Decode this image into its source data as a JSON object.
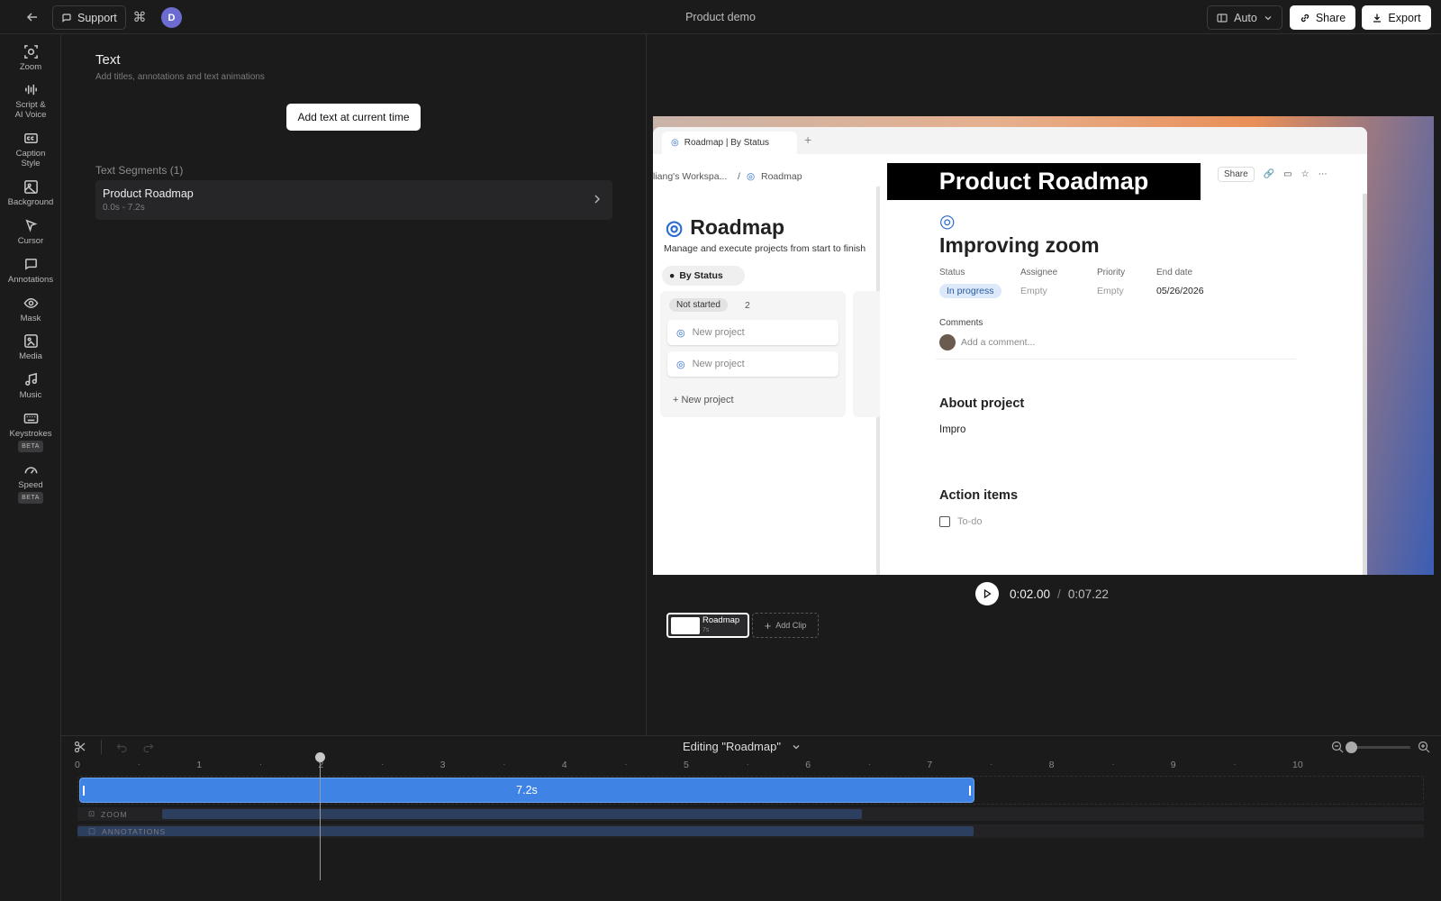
{
  "topbar": {
    "back_icon": "arrow-left-icon",
    "support_label": "Support",
    "avatar_initial": "D",
    "title": "Product demo",
    "aspect_label": "Auto",
    "share_label": "Share",
    "export_label": "Export"
  },
  "rail": {
    "items": [
      {
        "label": "Zoom",
        "icon": "zoom-icon"
      },
      {
        "label": "Script &",
        "label2": "AI Voice",
        "icon": "waveform-icon"
      },
      {
        "label": "Caption",
        "label2": "Style",
        "icon": "caption-icon"
      },
      {
        "label": "Background",
        "icon": "image-icon"
      },
      {
        "label": "Cursor",
        "icon": "cursor-icon"
      },
      {
        "label": "Annotations",
        "icon": "annotation-icon"
      },
      {
        "label": "Mask",
        "icon": "eye-icon"
      },
      {
        "label": "Media",
        "icon": "media-icon"
      },
      {
        "label": "Music",
        "icon": "music-icon"
      },
      {
        "label": "Keystrokes",
        "badge": "BETA",
        "icon": "keyboard-icon"
      },
      {
        "label": "Speed",
        "badge": "BETA",
        "icon": "speed-icon"
      }
    ]
  },
  "panel": {
    "title": "Text",
    "subtitle": "Add titles, annotations and text animations",
    "add_button": "Add text at current time",
    "segments_heading": "Text Segments (1)",
    "segments": [
      {
        "name": "Product Roadmap",
        "time": "0.0s - 7.2s"
      }
    ]
  },
  "preview": {
    "tab_label": "Roadmap | By Status",
    "crumb_workspace": "liang's Workspa...",
    "crumb_sep": "/",
    "crumb_page": "Roadmap",
    "overlay_text": "Product Roadmap",
    "share_label": "Share",
    "roadmap_title": "Roadmap",
    "roadmap_sub": "Manage and execute projects from start to finish",
    "view_label": "By Status",
    "column_status": "Not started",
    "column_count": "2",
    "cards": [
      "New project",
      "New project"
    ],
    "new_project": "New project",
    "page_title": "Improving zoom",
    "props": {
      "status": "Status",
      "assignee": "Assignee",
      "priority": "Priority",
      "end_date": "End date",
      "status_val": "In progress",
      "assignee_val": "Empty",
      "priority_val": "Empty",
      "end_date_val": "05/26/2026"
    },
    "comments_label": "Comments",
    "add_comment": "Add a comment...",
    "about_heading": "About project",
    "about_text": "Impro",
    "action_heading": "Action items",
    "todo": "To-do"
  },
  "player": {
    "current": "0:02.00",
    "separator": "/",
    "total": "0:07.22"
  },
  "clips": {
    "clip_name": "Roadmap",
    "clip_duration": "7s",
    "add_clip": "Add Clip"
  },
  "timeline": {
    "editing_label": "Editing \"Roadmap\"",
    "ticks": [
      "0",
      "1",
      "2",
      "3",
      "4",
      "5",
      "6",
      "7",
      "8",
      "9",
      "10"
    ],
    "main_track_label": "7.2s",
    "main_track_seconds": 7.2,
    "playhead_seconds": 2.0,
    "zoom_track_label": "ZOOM",
    "annotations_track_label": "ANNOTATIONS"
  },
  "colors": {
    "accent": "#3f84e5",
    "background": "#1b1b1c",
    "avatar": "#6c6bd1"
  }
}
